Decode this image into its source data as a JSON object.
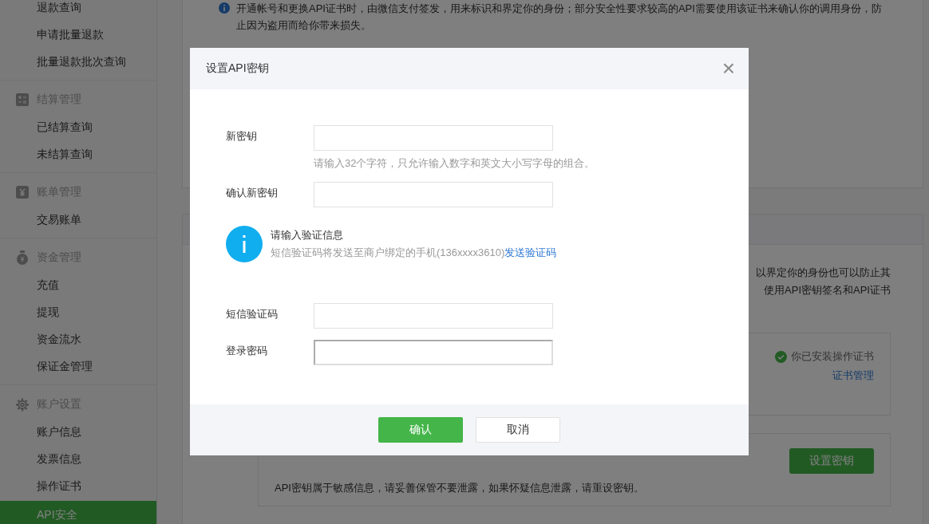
{
  "sidebar": {
    "groups": [
      {
        "items": [
          {
            "label": "退款查询",
            "selected": false
          },
          {
            "label": "申请批量退款",
            "selected": false
          },
          {
            "label": "批量退款批次查询",
            "selected": false
          }
        ]
      },
      {
        "title": "结算管理",
        "items": [
          {
            "label": "已结算查询",
            "selected": false
          },
          {
            "label": "未结算查询",
            "selected": false
          }
        ]
      },
      {
        "title": "账单管理",
        "items": [
          {
            "label": "交易账单",
            "selected": false
          }
        ]
      },
      {
        "title": "资金管理",
        "items": [
          {
            "label": "充值",
            "selected": false
          },
          {
            "label": "提现",
            "selected": false
          },
          {
            "label": "资金流水",
            "selected": false
          },
          {
            "label": "保证金管理",
            "selected": false
          }
        ]
      },
      {
        "title": "账户设置",
        "items": [
          {
            "label": "账户信息",
            "selected": false
          },
          {
            "label": "发票信息",
            "selected": false
          },
          {
            "label": "操作证书",
            "selected": false
          },
          {
            "label": "API安全",
            "selected": true
          }
        ]
      }
    ]
  },
  "background": {
    "notice": "开通帐号和更换API证书时，由微信支付签发，用来标识和界定你的身份；部分安全性要求较高的API需要使用该证书来确认你的调用身份，防止因为盗用而给你带来损失。",
    "api_notes": [
      "以界定你的身份也可以防止其",
      "使用API密钥签名和API证书"
    ],
    "cert_status": "你已安装操作证书",
    "cert_link": "证书管理",
    "key_button": "设置密钥",
    "key_note": "API密钥属于敏感信息，请妥善保管不要泄露，如果怀疑信息泄露，请重设密钥。"
  },
  "dialog": {
    "title": "设置API密钥",
    "close": "×",
    "fields_top": [
      {
        "label": "新密钥",
        "hint": "请输入32个字符，只允许输入数字和英文大小写字母的组合。",
        "focused": false
      },
      {
        "label": "确认新密钥",
        "focused": false
      }
    ],
    "verify": {
      "title": "请输入验证信息",
      "text": "短信验证码将发送至商户绑定的手机(136xxxx3610)",
      "link": "发送验证码"
    },
    "fields_bottom": [
      {
        "label": "短信验证码",
        "focused": false
      },
      {
        "label": "登录密码",
        "focused": true
      }
    ],
    "buttons": [
      {
        "label": "确认",
        "kind": "primary"
      },
      {
        "label": "取消",
        "kind": "default"
      }
    ]
  }
}
